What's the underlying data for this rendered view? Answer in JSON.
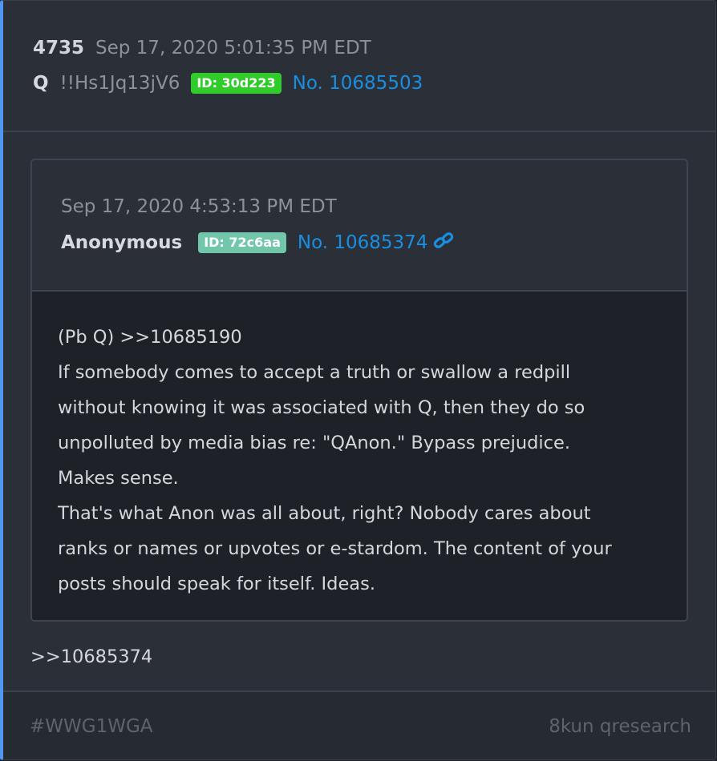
{
  "post": {
    "number": "4735",
    "timestamp": "Sep 17, 2020 5:01:35 PM EDT",
    "author": "Q",
    "tripcode": "!!Hs1Jq13jV6",
    "id_badge": "ID: 30d223",
    "id_color": "#2fcc2a",
    "post_link": "No. 10685503",
    "reply_text": ">>10685374"
  },
  "quoted": {
    "timestamp": "Sep 17, 2020 4:53:13 PM EDT",
    "author": "Anonymous",
    "id_badge": "ID: 72c6aa",
    "id_color": "#72c6aa",
    "post_link": "No. 10685374",
    "link_icon": "chain-link-icon",
    "body_lines": [
      "(Pb Q) >>10685190",
      "If somebody comes to accept a truth or swallow a redpill",
      "without knowing it was associated with Q, then they do so",
      "unpolluted by media bias re: \"QAnon.\" Bypass prejudice.",
      "Makes sense.",
      "That's what Anon was all about, right? Nobody cares about",
      "ranks or names or upvotes or e-stardom. The content of your",
      "posts should speak for itself. Ideas."
    ]
  },
  "footer": {
    "hashtag": "#WWG1WGA",
    "source": "8kun qresearch"
  },
  "colors": {
    "accent": "#4f97f0",
    "link": "#1a8ee0"
  }
}
